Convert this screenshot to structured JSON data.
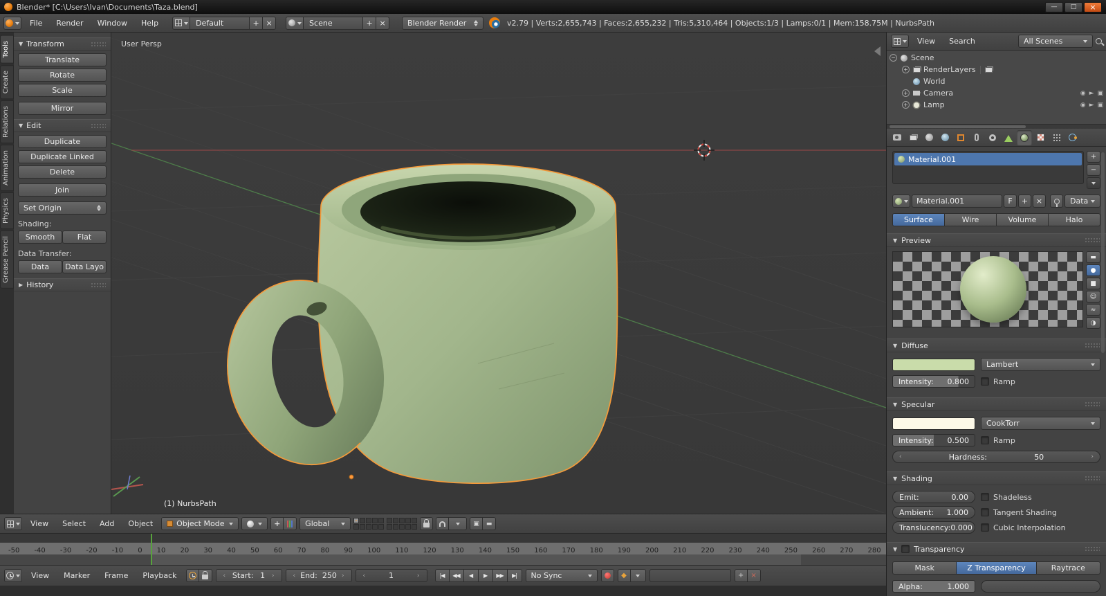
{
  "titlebar": {
    "title": "Blender* [C:\\Users\\Ivan\\Documents\\Taza.blend]"
  },
  "infobar": {
    "menu_file": "File",
    "menu_render": "Render",
    "menu_window": "Window",
    "menu_help": "Help",
    "layout_name": "Default",
    "scene_name": "Scene",
    "engine": "Blender Render",
    "stats": "v2.79 | Verts:2,655,743 | Faces:2,655,232 | Tris:5,310,464 | Objects:1/3 | Lamps:0/1 | Mem:158.75M | NurbsPath"
  },
  "tabs": {
    "tools": "Tools",
    "create": "Create",
    "relations": "Relations",
    "animation": "Animation",
    "physics": "Physics",
    "grease_pencil": "Grease Pencil"
  },
  "toolshelf": {
    "transform_title": "Transform",
    "translate": "Translate",
    "rotate": "Rotate",
    "scale": "Scale",
    "mirror": "Mirror",
    "edit_title": "Edit",
    "duplicate": "Duplicate",
    "duplicate_linked": "Duplicate Linked",
    "delete": "Delete",
    "join": "Join",
    "set_origin": "Set Origin",
    "shading_label": "Shading:",
    "smooth": "Smooth",
    "flat": "Flat",
    "data_transfer_label": "Data Transfer:",
    "data": "Data",
    "data_layout": "Data Layo",
    "history_title": "History"
  },
  "viewport": {
    "view_label": "User Persp",
    "object_info": "(1) NurbsPath",
    "menu_view": "View",
    "menu_select": "Select",
    "menu_add": "Add",
    "menu_object": "Object",
    "mode": "Object Mode",
    "orientation": "Global"
  },
  "outliner": {
    "menu_view": "View",
    "menu_search": "Search",
    "scope": "All Scenes",
    "scene": "Scene",
    "render_layers": "RenderLayers",
    "world": "World",
    "camera": "Camera",
    "lamp": "Lamp"
  },
  "properties": {
    "slot_name": "Material.001",
    "material_name": "Material.001",
    "fake_user": "F",
    "link": "Data",
    "surface": "Surface",
    "wire": "Wire",
    "volume": "Volume",
    "halo": "Halo",
    "preview_title": "Preview",
    "diffuse_title": "Diffuse",
    "diffuse_shader": "Lambert",
    "intensity_label": "Intensity:",
    "diffuse_intensity": "0.800",
    "ramp": "Ramp",
    "diffuse_color": "#c9dcaa",
    "specular_title": "Specular",
    "specular_shader": "CookTorr",
    "specular_intensity": "0.500",
    "specular_color": "#fdf9e8",
    "hardness_label": "Hardness:",
    "hardness": "50",
    "shading_title": "Shading",
    "emit_label": "Emit:",
    "emit": "0.00",
    "shadeless": "Shadeless",
    "ambient_label": "Ambient:",
    "ambient": "1.000",
    "tangent": "Tangent Shading",
    "translucency_label": "Translucency:",
    "translucency": "0.000",
    "cubic": "Cubic Interpolation",
    "transparency_title": "Transparency",
    "mask": "Mask",
    "ztransparency": "Z Transparency",
    "raytrace": "Raytrace",
    "alpha_label": "Alpha:",
    "alpha": "1.000"
  },
  "timeline": {
    "menu_view": "View",
    "menu_marker": "Marker",
    "menu_frame": "Frame",
    "menu_playback": "Playback",
    "start_label": "Start:",
    "start": "1",
    "end_label": "End:",
    "end": "250",
    "current_frame": "1",
    "sync": "No Sync",
    "ruler": [
      "-50",
      "-40",
      "-30",
      "-20",
      "-10",
      "0",
      "10",
      "20",
      "30",
      "40",
      "50",
      "60",
      "70",
      "80",
      "90",
      "100",
      "110",
      "120",
      "130",
      "140",
      "150",
      "160",
      "170",
      "180",
      "190",
      "200",
      "210",
      "220",
      "230",
      "240",
      "250",
      "260",
      "270",
      "280"
    ]
  },
  "icons": {
    "minimize": "—",
    "maximize": "□",
    "close": "×",
    "tri_down": "▼",
    "tri_right": "▶",
    "plus": "+",
    "cross": "×",
    "minus": "−",
    "preview_flat": "▬",
    "preview_sphere": "●",
    "preview_cube": "■",
    "preview_monkey": "☺",
    "preview_hair": "≈",
    "preview_world": "◑",
    "pb_jump_start": "|◀",
    "pb_prev_key": "◀◀",
    "pb_play_rev": "◀",
    "pb_play": "▶",
    "pb_next_key": "▶▶",
    "pb_jump_end": "▶|",
    "key_diamond": "◆",
    "eye": "◉",
    "select_arrow": "►",
    "render_restrict": "▣"
  }
}
